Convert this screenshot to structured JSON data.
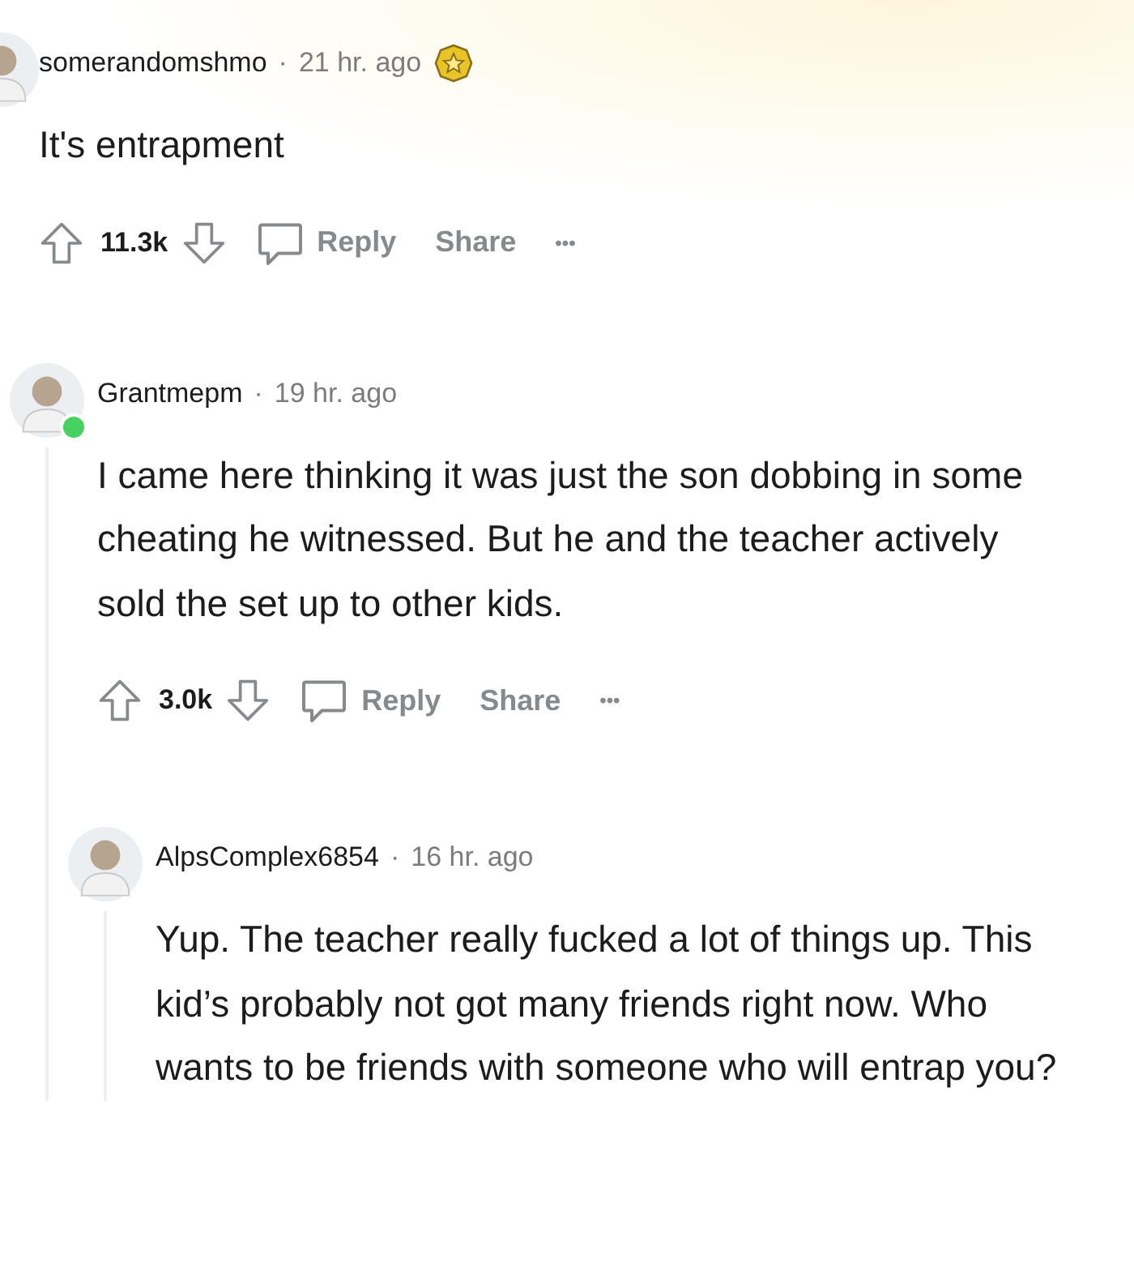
{
  "comments": [
    {
      "username": "somerandomshmo",
      "sep": "·",
      "time": "21 hr. ago",
      "awarded": true,
      "online": false,
      "body": [
        "It's entrapment"
      ],
      "score": "11.3k",
      "actions": [
        "Reply",
        "Share"
      ],
      "more": "•••",
      "children": [
        {
          "username": "Grantmepm",
          "sep": "·",
          "time": "19 hr. ago",
          "awarded": false,
          "online": true,
          "body": [
            "I came here thinking it was just the son dobbing in some cheating he witnessed. But he and the teacher actively sold the set up to other kids."
          ],
          "score": "3.0k",
          "actions": [
            "Reply",
            "Share"
          ],
          "more": "•••",
          "children": [
            {
              "username": "AlpsComplex6854",
              "sep": "·",
              "time": "16 hr. ago",
              "awarded": false,
              "online": false,
              "body": [
                "Yup. The teacher really fucked a lot of things up. This kid’s probably not got many friends right now. Who wants to be friends with someone who will entrap you?"
              ]
            }
          ]
        }
      ]
    }
  ]
}
